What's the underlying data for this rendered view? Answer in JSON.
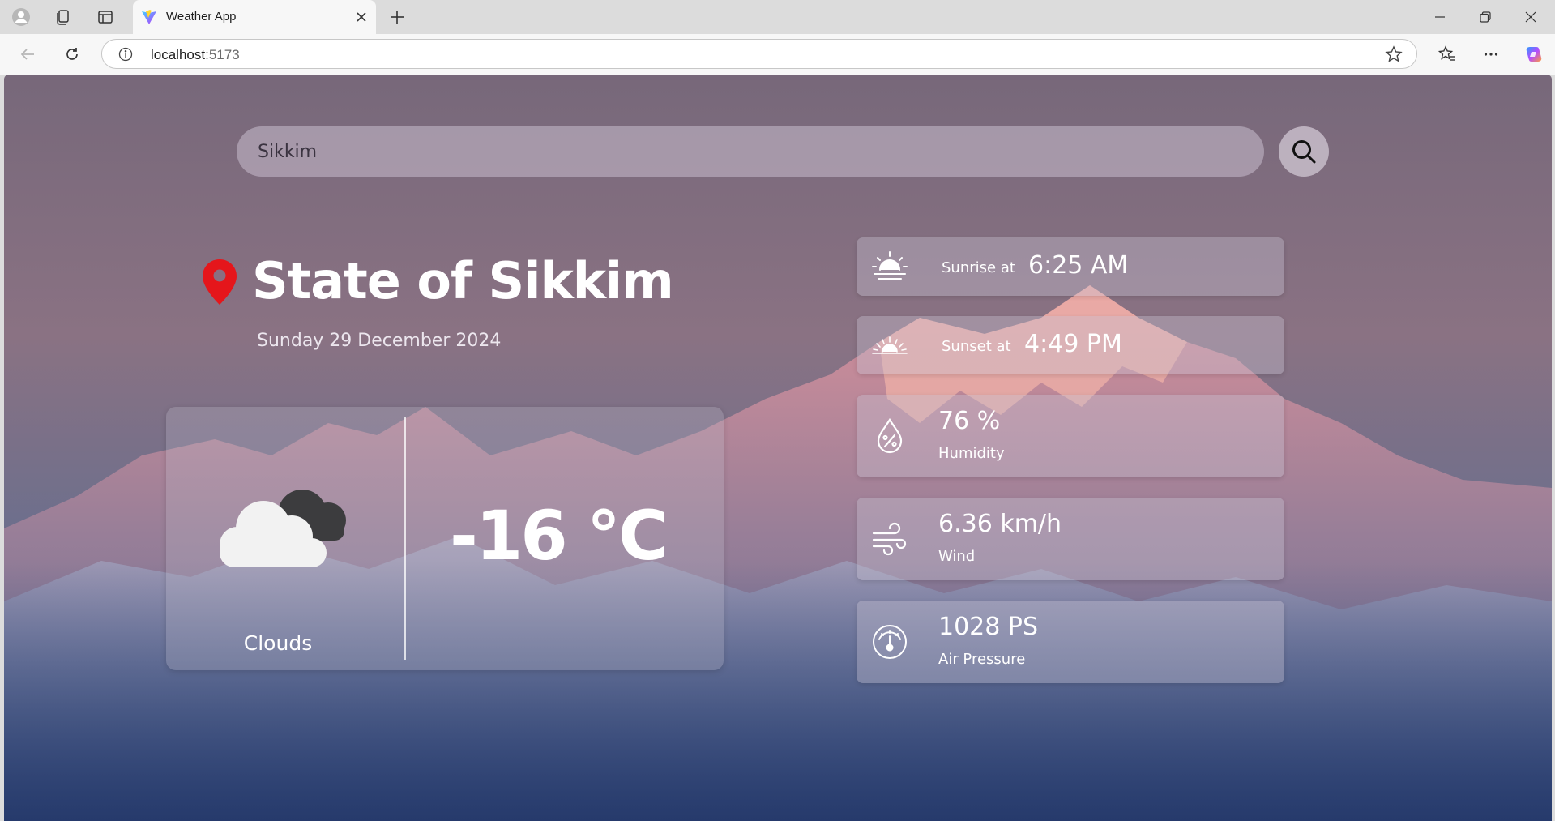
{
  "browser": {
    "tab_title": "Weather App",
    "url_host": "localhost",
    "url_port": ":5173"
  },
  "search": {
    "value": "Sikkim"
  },
  "location": {
    "city": "State of Sikkim",
    "date": "Sunday 29 December 2024"
  },
  "current": {
    "temperature": "-16 °C",
    "condition": "Clouds"
  },
  "sun": {
    "sunrise_label": "Sunrise at",
    "sunrise_time": "6:25 AM",
    "sunset_label": "Sunset at",
    "sunset_time": "4:49 PM"
  },
  "stats": {
    "humidity_value": "76 %",
    "humidity_label": "Humidity",
    "wind_value": "6.36 km/h",
    "wind_label": "Wind",
    "pressure_value": "1028 PS",
    "pressure_label": "Air Pressure"
  },
  "icons": {
    "location": "map-pin-icon",
    "search": "search-icon",
    "weather": "cloud-icon",
    "sunrise": "sunrise-icon",
    "sunset": "sunset-icon",
    "humidity": "humidity-drop-icon",
    "wind": "wind-icon",
    "pressure": "gauge-icon"
  },
  "colors": {
    "pin": "#e5161b",
    "text": "#ffffff"
  }
}
